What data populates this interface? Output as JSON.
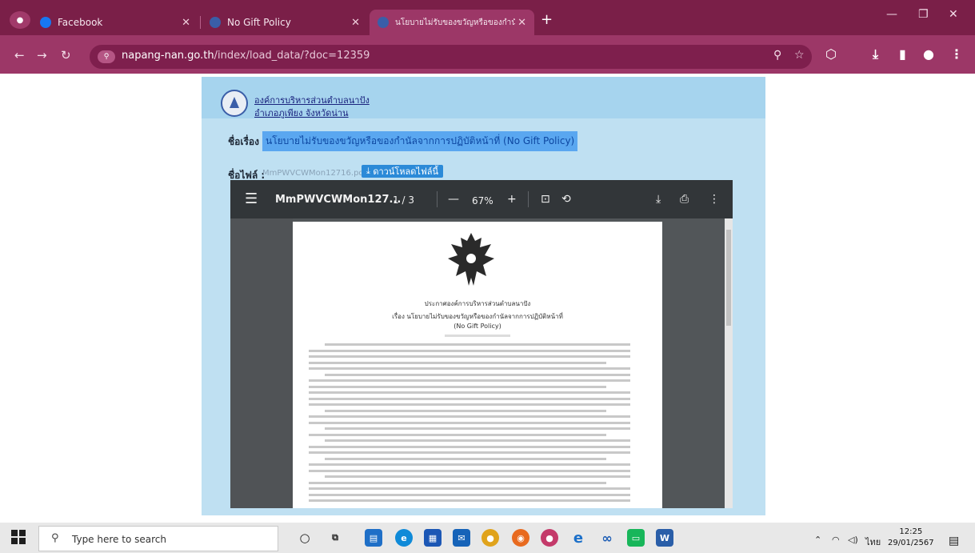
{
  "browser": {
    "tabs": [
      {
        "label": "Facebook",
        "favicon_color": "#1877f2"
      },
      {
        "label": "No Gift Policy",
        "favicon_color": "#3a5ea8"
      },
      {
        "label": "นโยบายไม่รับของขวัญหรือของกำนัล·",
        "favicon_color": "#3a5ea8"
      }
    ],
    "url_domain": "napang-nan.go.th",
    "url_path": "/index/load_data/?doc=12359"
  },
  "page": {
    "org_name": "องค์การบริหารส่วนตำบลนาปัง",
    "org_location": "อำเภอภูเพียง จังหวัดน่าน",
    "subject_label": "ชื่อเรื่อง :",
    "subject_value": "นโยบายไม่รับของขวัญหรือของกำนัลจากการปฏิบัติหน้าที่ (No Gift Policy)",
    "file_label": "ชื่อไฟล์ :",
    "file_name": "MmPWVCWMon12716.pdf",
    "download_label": "ดาวน์โหลดไฟล์นี้"
  },
  "pdf_viewer": {
    "file_name": "MmPWVCWMon127...",
    "page_current": "1",
    "page_total": "3",
    "zoom": "67%",
    "doc_heading": "ประกาศองค์การบริหารส่วนตำบลนาปัง",
    "doc_subject": "เรื่อง  นโยบายไม่รับของขวัญหรือของกำนัลจากการปฏิบัติหน้าที่",
    "doc_policy": "(No Gift Policy)"
  },
  "taskbar": {
    "search_placeholder": "Type here to search",
    "language": "ไทย",
    "time": "12:25",
    "date": "29/01/2567"
  },
  "colors": {
    "titlebar": "#7a1f48",
    "toolbar": "#9c3767",
    "page_bg": "#bfe0f2",
    "highlight": "#5aa7f0"
  }
}
